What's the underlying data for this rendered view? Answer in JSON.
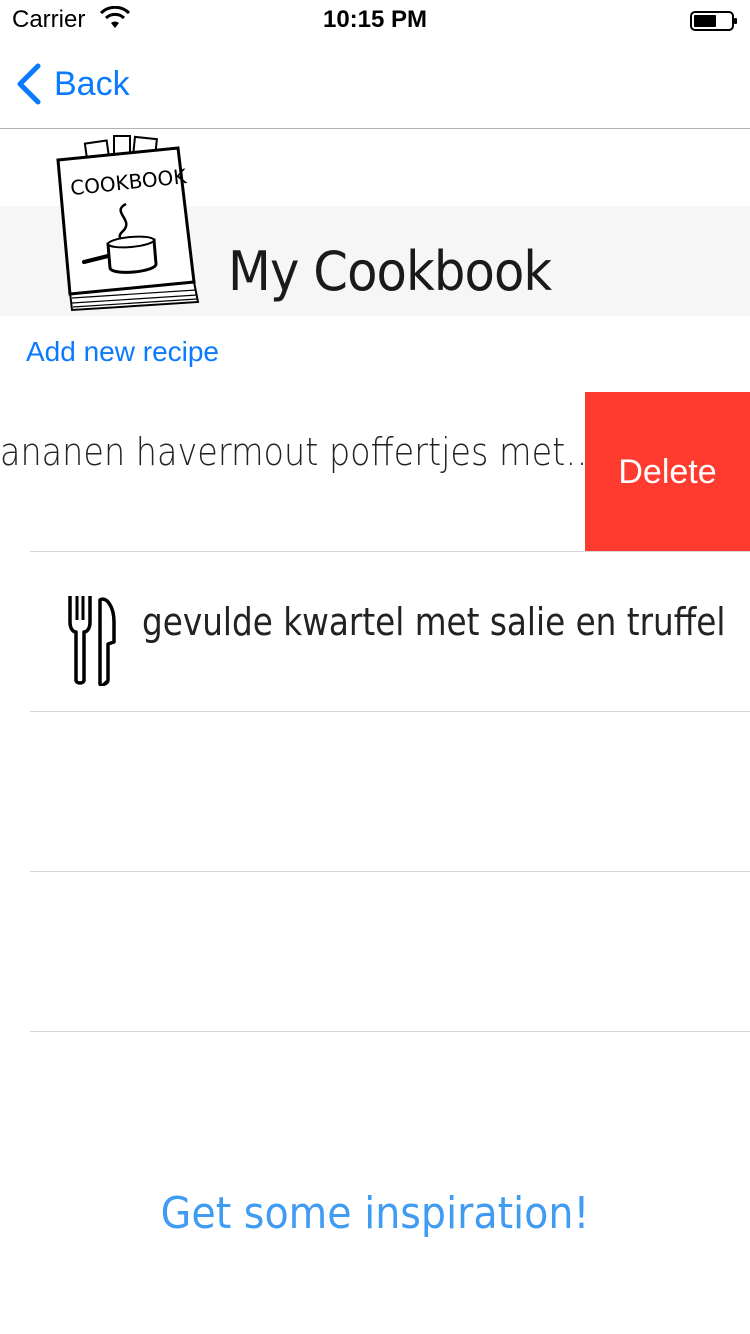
{
  "status_bar": {
    "carrier": "Carrier",
    "time": "10:15 PM",
    "icons": [
      "wifi-icon",
      "battery-icon"
    ]
  },
  "nav_bar": {
    "back_label": "Back",
    "back_icon": "chevron-left-icon",
    "accent_color": "#0a7aff"
  },
  "header": {
    "title": "My Cookbook",
    "image_text": "COOKBOOK",
    "add_recipe_label": "Add new recipe"
  },
  "recipes": [
    {
      "title": "ananen havermout poffertjes met…",
      "swiped": true,
      "delete_label": "Delete",
      "delete_color": "#ff3b30"
    },
    {
      "title": "gevulde kwartel met salie en truffel",
      "icon": "cutlery-icon"
    }
  ],
  "footer": {
    "inspiration_label": "Get some inspiration!"
  }
}
